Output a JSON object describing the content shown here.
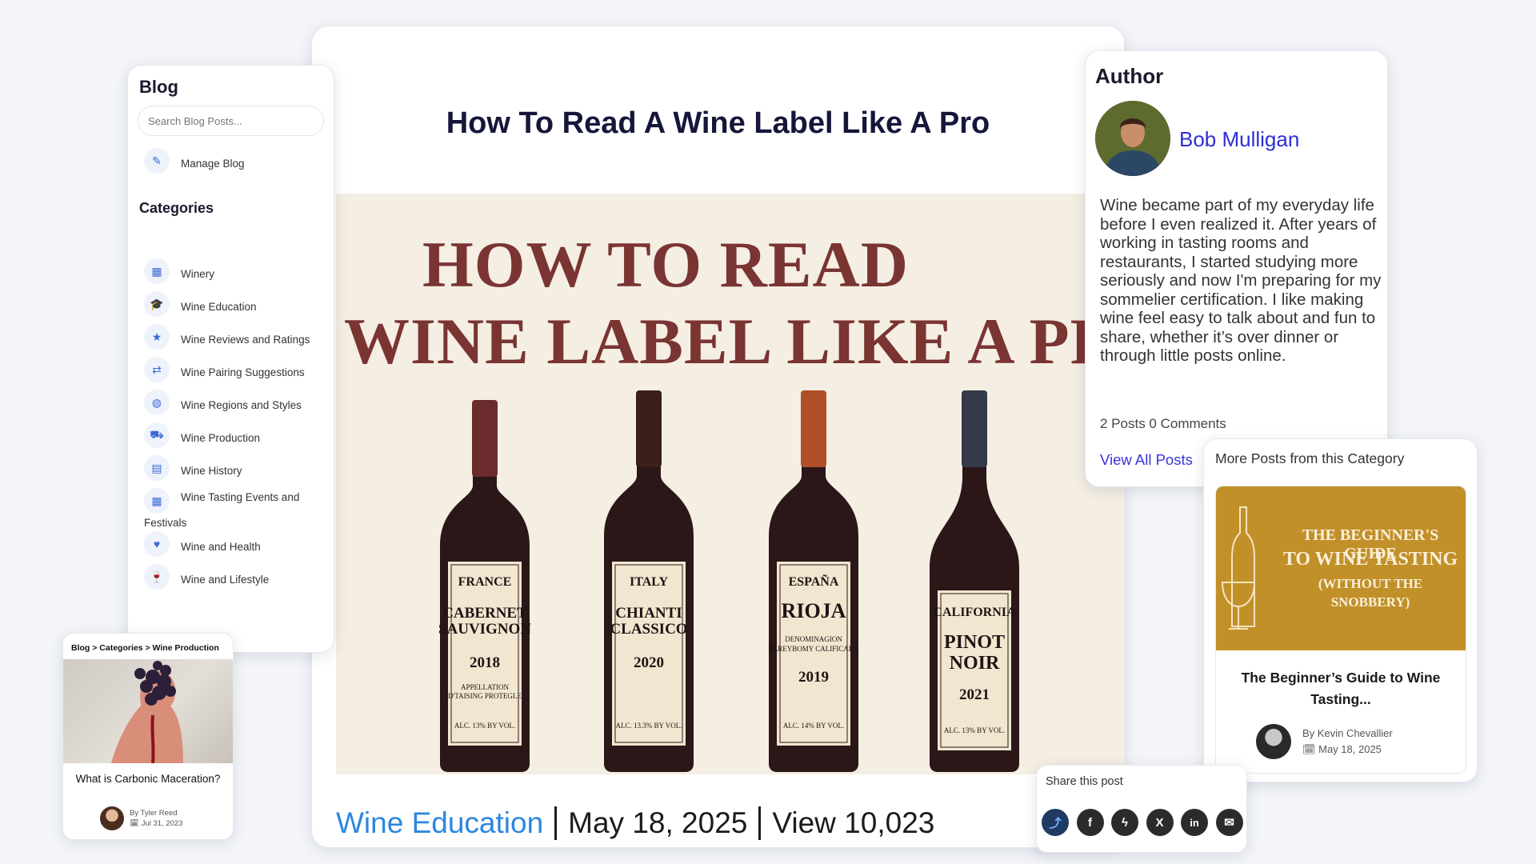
{
  "sidebar": {
    "title": "Blog",
    "search_placeholder": "Search Blog Posts...",
    "manage_label": "Manage Blog",
    "categories_heading": "Categories",
    "categories": [
      {
        "label": "Winery",
        "icon": "building-icon"
      },
      {
        "label": "Wine Education",
        "icon": "graduation-cap-icon"
      },
      {
        "label": "Wine Reviews and Ratings",
        "icon": "star-icon"
      },
      {
        "label": "Wine Pairing Suggestions",
        "icon": "swap-arrows-icon"
      },
      {
        "label": "Wine Regions and Styles",
        "icon": "globe-icon"
      },
      {
        "label": "Wine Production",
        "icon": "tractor-icon"
      },
      {
        "label": "Wine History",
        "icon": "book-icon"
      },
      {
        "label": "Wine Tasting Events and Festivals",
        "icon": "calendar-icon"
      },
      {
        "label": "Wine and Health",
        "icon": "heart-pulse-icon"
      },
      {
        "label": "Wine and Lifestyle",
        "icon": "wine-glass-icon"
      }
    ]
  },
  "article": {
    "title": "How To Read A Wine Label Like A Pro",
    "hero": {
      "line1": "HOW TO READ",
      "line2": "WINE LABEL LIKE A PR",
      "bottles": [
        {
          "region": "FRANCE",
          "name_1": "CABERNET",
          "name_2": "SAUVIGNON",
          "year": "2018",
          "extra_1": "APPELLATION",
          "extra_2": "D'TAISING PROTEGLE",
          "alc": "ALC. 13% BY VOL.",
          "cap_color": "#6b2a2b"
        },
        {
          "region": "ITALY",
          "name_1": "CHIANTI",
          "name_2": "CLASSICO",
          "year": "2020",
          "extra_1": "",
          "extra_2": "",
          "alc": "ALC. 13.3% BY VOL.",
          "cap_color": "#3b1f1d"
        },
        {
          "region": "ESPAÑA",
          "name_1": "RIOJA",
          "name_2": "",
          "year": "2019",
          "extra_1": "DENOMINAGION",
          "extra_2": "EAREYBOMY CALIFICADA",
          "alc": "ALC. 14% BY VOL.",
          "cap_color": "#b0502a"
        },
        {
          "region": "CALIFORNIA",
          "name_1": "PINOT",
          "name_2": "NOIR",
          "year": "2021",
          "extra_1": "",
          "extra_2": "",
          "alc": "ALC. 13% BY VOL.",
          "cap_color": "#343a48"
        }
      ]
    },
    "category": "Wine Education",
    "date": "May 18, 2025",
    "views": "View 10,023"
  },
  "breadcrumb_card": {
    "crumb": "Blog > Categories > Wine Production",
    "post_title": "What is Carbonic Maceration?",
    "author": "By Tyler Reed",
    "date": "Jul 31, 2023"
  },
  "author": {
    "heading": "Author",
    "name": "Bob Mulligan",
    "bio": "Wine became part of my everyday life before I even realized it. After years of working in tasting rooms and restaurants, I started studying more seriously and now I'm preparing for my sommelier certification. I like making wine feel easy to talk about and fun to share, whether it’s over dinner or through little posts online.",
    "stats": "2 Posts 0 Comments",
    "view_all": "View All Posts"
  },
  "more_posts": {
    "heading": "More Posts from this Category",
    "image_line1": "THE BEGINNER'S GUIDE",
    "image_line2": "TO WINE TASTING",
    "image_line3": "(WITHOUT THE",
    "image_line4": "SNOBBERY)",
    "title": "The Beginner’s Guide to Wine Tasting...",
    "by": "By",
    "author": "Kevin Chevallier",
    "date": "May 18, 2025"
  },
  "share": {
    "label": "Share this post",
    "icons": [
      "share-icon",
      "facebook-icon",
      "messenger-icon",
      "x-icon",
      "linkedin-icon",
      "email-icon"
    ]
  }
}
